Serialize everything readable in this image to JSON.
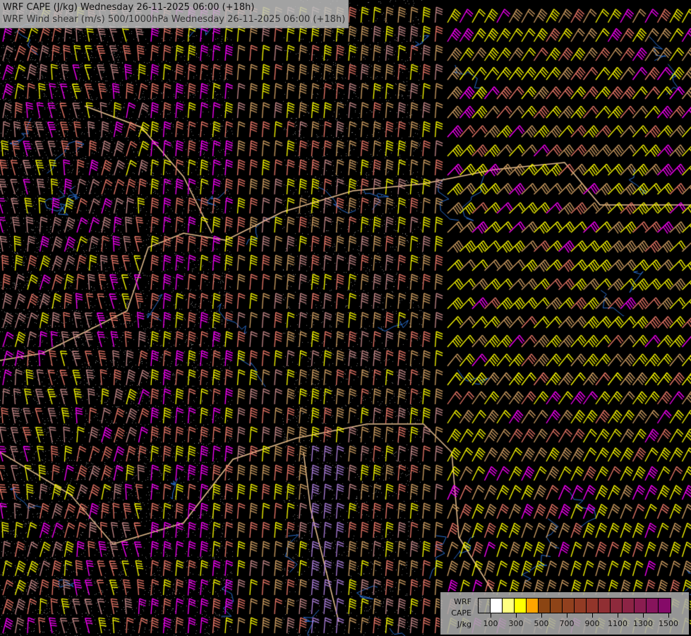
{
  "header": {
    "title_line1": "WRF CAPE (J/kg) Wednesday 26-11-2025 06:00 (+18h)",
    "title_line2": "WRF Wind shear (m/s) 500/1000hPa Wednesday 26-11-2025 06:00 (+18h)"
  },
  "legend": {
    "label_line1": "WRF",
    "label_line2": "CAPE",
    "label_line3": "J/kg",
    "colors": [
      "transparent",
      "#ffffff",
      "#ffff80",
      "#ffff00",
      "#ffa500",
      "#8b4513",
      "#8e4418",
      "#91401e",
      "#923b24",
      "#92352a",
      "#902f33",
      "#8e2a3c",
      "#8c2445",
      "#8a1d50",
      "#87145c",
      "#850a68"
    ],
    "ticks": [
      "100",
      "300",
      "500",
      "700",
      "900",
      "1100",
      "1300",
      "1500"
    ]
  },
  "barb_colors": [
    "#ffff00",
    "#d4a264",
    "#f07a6a",
    "#ff00ff",
    "#c88a8a",
    "#b080e0"
  ]
}
